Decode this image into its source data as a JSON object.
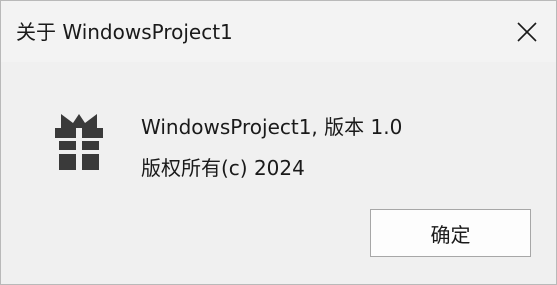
{
  "window": {
    "title": "关于 WindowsProject1"
  },
  "titlebar": {
    "close_icon": "close-icon"
  },
  "content": {
    "app_icon": "gift-icon",
    "version_line": "WindowsProject1, 版本 1.0",
    "copyright_line": "版权所有(c) 2024"
  },
  "buttons": {
    "ok_label": "确定"
  },
  "colors": {
    "titlebar_bg": "#f3f3f3",
    "client_bg": "#f0f0f0",
    "text": "#1a1a1a",
    "icon": "#3a3a3a",
    "button_border": "#a7a7a7"
  }
}
